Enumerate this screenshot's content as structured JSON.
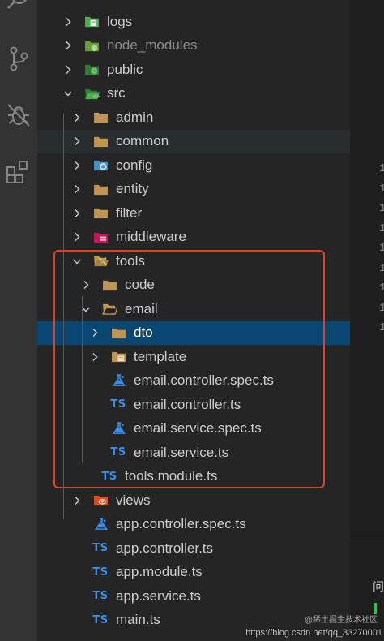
{
  "activity_bar": {
    "icons": [
      "search-icon",
      "source-control-icon",
      "debug-icon",
      "extensions-icon"
    ]
  },
  "explorer": {
    "rows": [
      {
        "label": "logs",
        "icon": "folder-logs-icon",
        "depth": 1,
        "chevron": "right"
      },
      {
        "label": "node_modules",
        "icon": "folder-node-icon",
        "depth": 1,
        "chevron": "right",
        "dim": true
      },
      {
        "label": "public",
        "icon": "folder-public-icon",
        "depth": 1,
        "chevron": "right"
      },
      {
        "label": "src",
        "icon": "folder-src-open-icon",
        "depth": 1,
        "chevron": "down"
      },
      {
        "label": "admin",
        "icon": "folder-icon",
        "depth": 2,
        "chevron": "right"
      },
      {
        "label": "common",
        "icon": "folder-icon",
        "depth": 2,
        "chevron": "right"
      },
      {
        "label": "config",
        "icon": "folder-config-icon",
        "depth": 2,
        "chevron": "right"
      },
      {
        "label": "entity",
        "icon": "folder-icon",
        "depth": 2,
        "chevron": "right"
      },
      {
        "label": "filter",
        "icon": "folder-icon",
        "depth": 2,
        "chevron": "right"
      },
      {
        "label": "middleware",
        "icon": "folder-middleware-icon",
        "depth": 2,
        "chevron": "right"
      },
      {
        "label": "tools",
        "icon": "folder-tools-open-icon",
        "depth": 2,
        "chevron": "down"
      },
      {
        "label": "code",
        "icon": "folder-icon",
        "depth": 3,
        "chevron": "right"
      },
      {
        "label": "email",
        "icon": "folder-open-icon",
        "depth": 3,
        "chevron": "down"
      },
      {
        "label": "dto",
        "icon": "folder-icon",
        "depth": 4,
        "chevron": "right",
        "selected": true
      },
      {
        "label": "template",
        "icon": "folder-template-icon",
        "depth": 4,
        "chevron": "right"
      },
      {
        "label": "email.controller.spec.ts",
        "icon": "test-flask-icon",
        "depth": 4,
        "chevron": "none"
      },
      {
        "label": "email.controller.ts",
        "icon": "typescript-icon",
        "depth": 4,
        "chevron": "none"
      },
      {
        "label": "email.service.spec.ts",
        "icon": "test-flask-icon",
        "depth": 4,
        "chevron": "none"
      },
      {
        "label": "email.service.ts",
        "icon": "typescript-icon",
        "depth": 4,
        "chevron": "none"
      },
      {
        "label": "tools.module.ts",
        "icon": "typescript-icon",
        "depth": 3,
        "chevron": "none"
      },
      {
        "label": "views",
        "icon": "folder-views-icon",
        "depth": 2,
        "chevron": "right"
      },
      {
        "label": "app.controller.spec.ts",
        "icon": "test-flask-icon",
        "depth": 2,
        "chevron": "none"
      },
      {
        "label": "app.controller.ts",
        "icon": "typescript-icon",
        "depth": 2,
        "chevron": "none"
      },
      {
        "label": "app.module.ts",
        "icon": "typescript-icon",
        "depth": 2,
        "chevron": "none"
      },
      {
        "label": "app.service.ts",
        "icon": "typescript-icon",
        "depth": 2,
        "chevron": "none"
      },
      {
        "label": "main.ts",
        "icon": "typescript-icon",
        "depth": 2,
        "chevron": "none"
      }
    ],
    "ts_badge": "TS"
  },
  "editor": {
    "line_numbers": [
      "1",
      "1",
      "1",
      "1",
      "1",
      "1",
      "1",
      "1",
      "1"
    ],
    "panel_text": "问"
  },
  "watermark": {
    "top": "@稀土掘金技术社区",
    "bottom": "https://blog.csdn.net/qq_33270001"
  },
  "colors": {
    "selection": "#094771",
    "highlight_box": "#e2402c",
    "folder": "#c09553",
    "ts_blue": "#3b8eea"
  }
}
